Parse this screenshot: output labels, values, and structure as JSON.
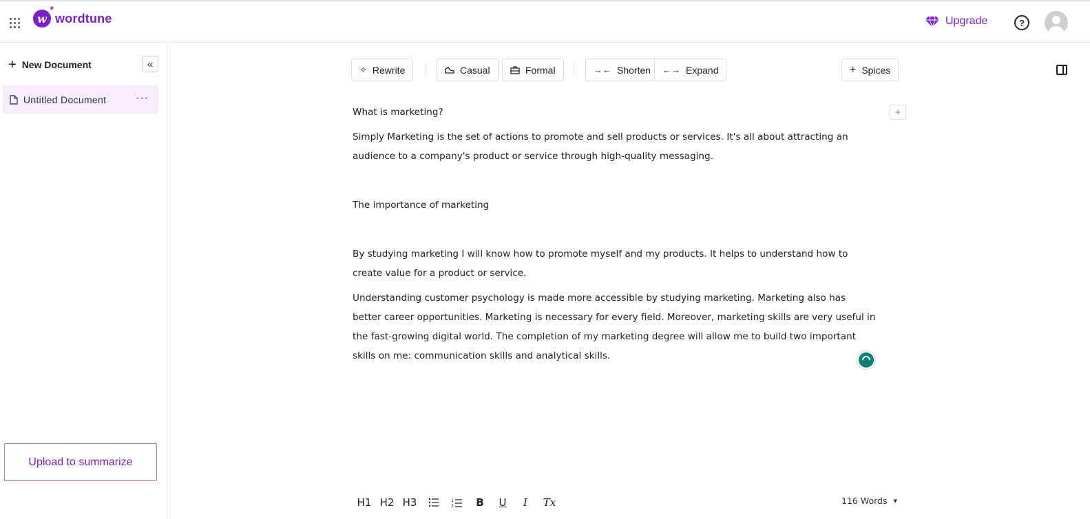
{
  "header": {
    "logo_text": "wordtune",
    "logo_mark": "w",
    "upgrade_label": "Upgrade",
    "help_glyph": "?",
    "brand_color": "#7e1fc6"
  },
  "sidebar": {
    "new_document_label": "New Document",
    "collapse_glyph": "«",
    "documents": [
      {
        "label": "Untitled Document",
        "menu_glyph": "···"
      }
    ],
    "upload_label": "Upload to summarize"
  },
  "toolbar": {
    "rewrite": "Rewrite",
    "casual": "Casual",
    "formal": "Formal",
    "shorten": "Shorten",
    "expand": "Expand",
    "spices": "Spices"
  },
  "document": {
    "paragraphs": [
      "What is marketing?",
      "Simply Marketing is the set of actions to promote and sell products or services. It's all about attracting an audience to a company's product or service through high-quality messaging.",
      "The importance of marketing",
      "By studying marketing I will know how to promote myself and my products. It helps to understand how to create value for a product or service.",
      "Understanding customer psychology is made more accessible by studying marketing. Marketing also has better career opportunities. Marketing is necessary for every field. Moreover, marketing skills are very useful in the fast-growing digital world. The completion of my marketing degree will allow me to build two important skills on me: communication skills and analytical skills."
    ]
  },
  "format_bar": {
    "h1": "H1",
    "h2": "H2",
    "h3": "H3",
    "bold": "B",
    "underline": "U",
    "italic": "I",
    "clear": "Tx",
    "word_count": "116 Words"
  },
  "assistant_color": "#0e8074"
}
